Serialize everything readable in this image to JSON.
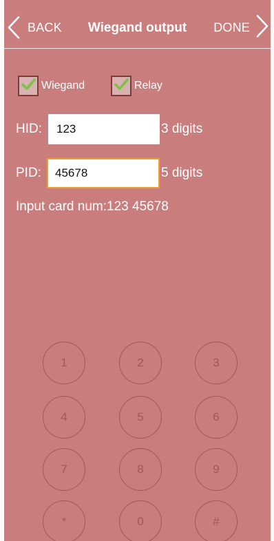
{
  "header": {
    "back_label": "BACK",
    "title": "Wiegand output",
    "done_label": "DONE"
  },
  "options": {
    "wiegand": {
      "label": "Wiegand",
      "checked": true
    },
    "relay": {
      "label": "Relay",
      "checked": true
    }
  },
  "fields": {
    "hid": {
      "label": "HID:",
      "value": "123",
      "hint": "3 digits"
    },
    "pid": {
      "label": "PID:",
      "value": "45678",
      "hint": "5 digits"
    }
  },
  "card_num": "Input card num:123 45678",
  "keypad": {
    "keys": [
      "1",
      "2",
      "3",
      "4",
      "5",
      "6",
      "7",
      "8",
      "9",
      "*",
      "0",
      "#"
    ]
  },
  "colors": {
    "background": "#c97e7d",
    "key_outline": "#a25756",
    "focus_border": "#f0a030",
    "check_mark": "#7cc243"
  }
}
